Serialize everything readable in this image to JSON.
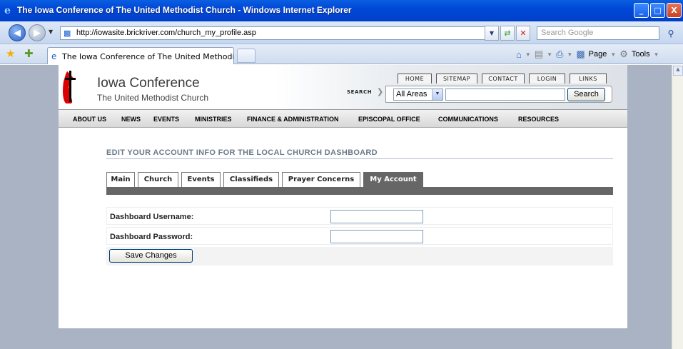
{
  "window": {
    "title": "The Iowa Conference of The United Methodist Church - Windows Internet Explorer",
    "buttons": [
      "_",
      "□",
      "X"
    ]
  },
  "browser": {
    "url": "http://iowasite.brickriver.com/church_my_profile.asp",
    "search_placeholder": "Search Google",
    "tab_title": "The Iowa Conference of The United Methodist Church",
    "toolbar": {
      "page_label": "Page",
      "tools_label": "Tools"
    }
  },
  "site": {
    "title": "Iowa Conference",
    "subtitle": "The United Methodist Church",
    "util_nav": [
      "HOME",
      "SITEMAP",
      "CONTACT",
      "LOGIN",
      "LINKS"
    ],
    "search_label": "SEARCH",
    "search_scope": "All Areas",
    "search_button": "Search",
    "main_nav": [
      "ABOUT US",
      "NEWS",
      "EVENTS",
      "MINISTRIES",
      "FINANCE & ADMINISTRATION",
      "EPISCOPAL OFFICE",
      "COMMUNICATIONS",
      "RESOURCES"
    ]
  },
  "account": {
    "heading": "EDIT YOUR ACCOUNT INFO FOR THE LOCAL CHURCH DASHBOARD",
    "tabs": [
      "Main",
      "Church",
      "Events",
      "Classifieds",
      "Prayer Concerns",
      "My Account"
    ],
    "active_tab": "My Account",
    "fields": [
      {
        "label": "Dashboard Username:",
        "value": ""
      },
      {
        "label": "Dashboard Password:",
        "value": ""
      }
    ],
    "save_label": "Save Changes"
  }
}
